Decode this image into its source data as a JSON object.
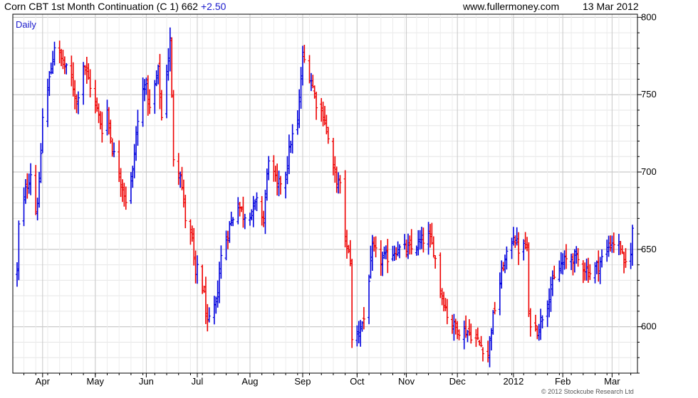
{
  "header": {
    "title": "Corn CBT 1st Month Continuation (C 1) 662",
    "change": "+2.50",
    "website": "www.fullermoney.com",
    "date": "13 Mar 2012"
  },
  "period_label": "Daily",
  "copyright": "© 2012 Stockcube Research Ltd",
  "colors": {
    "up": "#0000dd",
    "down": "#ee0000",
    "grid": "#d4d4d4",
    "axis": "#000000"
  },
  "chart_data": {
    "type": "ohlc",
    "title": "Corn CBT 1st Month Continuation (C 1) 662 +2.50",
    "y_ticks": [
      600,
      650,
      700,
      750,
      800
    ],
    "ylim": [
      570,
      802
    ],
    "grid": true,
    "y_axis_side": "right",
    "x_tick_labels": [
      "Apr",
      "May",
      "Jun",
      "Jul",
      "Aug",
      "Sep",
      "Oct",
      "Nov",
      "Dec",
      "2012",
      "Feb",
      "Mar"
    ],
    "x_tick_dates": [
      "2011-04-01",
      "2011-05-02",
      "2011-06-01",
      "2011-07-01",
      "2011-08-01",
      "2011-09-01",
      "2011-10-03",
      "2011-11-01",
      "2011-12-01",
      "2012-01-03",
      "2012-02-01",
      "2012-03-01"
    ],
    "date_range": [
      "2011-03-17",
      "2012-03-13"
    ],
    "path_points": [
      [
        "2011-03-17",
        635
      ],
      [
        "2011-03-18",
        665
      ],
      [
        "2011-03-22",
        688
      ],
      [
        "2011-03-25",
        700
      ],
      [
        "2011-03-28",
        675
      ],
      [
        "2011-03-30",
        690
      ],
      [
        "2011-04-01",
        735
      ],
      [
        "2011-04-05",
        760
      ],
      [
        "2011-04-08",
        782
      ],
      [
        "2011-04-13",
        770
      ],
      [
        "2011-04-18",
        760
      ],
      [
        "2011-04-21",
        745
      ],
      [
        "2011-04-25",
        770
      ],
      [
        "2011-04-28",
        760
      ],
      [
        "2011-05-03",
        740
      ],
      [
        "2011-05-06",
        728
      ],
      [
        "2011-05-09",
        740
      ],
      [
        "2011-05-12",
        715
      ],
      [
        "2011-05-17",
        695
      ],
      [
        "2011-05-20",
        682
      ],
      [
        "2011-05-24",
        700
      ],
      [
        "2011-05-26",
        725
      ],
      [
        "2011-05-31",
        760
      ],
      [
        "2011-06-03",
        740
      ],
      [
        "2011-06-08",
        765
      ],
      [
        "2011-06-10",
        735
      ],
      [
        "2011-06-13",
        765
      ],
      [
        "2011-06-15",
        785
      ],
      [
        "2011-06-17",
        710
      ],
      [
        "2011-06-21",
        700
      ],
      [
        "2011-06-24",
        670
      ],
      [
        "2011-06-28",
        655
      ],
      [
        "2011-06-30",
        630
      ],
      [
        "2011-07-01",
        640
      ],
      [
        "2011-07-05",
        620
      ],
      [
        "2011-07-07",
        600
      ],
      [
        "2011-07-12",
        615
      ],
      [
        "2011-07-15",
        645
      ],
      [
        "2011-07-20",
        665
      ],
      [
        "2011-07-25",
        680
      ],
      [
        "2011-07-28",
        672
      ],
      [
        "2011-08-02",
        675
      ],
      [
        "2011-08-05",
        680
      ],
      [
        "2011-08-09",
        670
      ],
      [
        "2011-08-12",
        710
      ],
      [
        "2011-08-17",
        690
      ],
      [
        "2011-08-22",
        700
      ],
      [
        "2011-08-25",
        720
      ],
      [
        "2011-08-29",
        732
      ],
      [
        "2011-09-01",
        775
      ],
      [
        "2011-09-06",
        760
      ],
      [
        "2011-09-09",
        745
      ],
      [
        "2011-09-14",
        735
      ],
      [
        "2011-09-19",
        700
      ],
      [
        "2011-09-23",
        690
      ],
      [
        "2011-09-27",
        650
      ],
      [
        "2011-09-29",
        645
      ],
      [
        "2011-09-30",
        590
      ],
      [
        "2011-10-05",
        600
      ],
      [
        "2011-10-07",
        605
      ],
      [
        "2011-10-12",
        650
      ],
      [
        "2011-10-17",
        643
      ],
      [
        "2011-10-21",
        645
      ],
      [
        "2011-10-26",
        650
      ],
      [
        "2011-11-01",
        650
      ],
      [
        "2011-11-04",
        650
      ],
      [
        "2011-11-09",
        655
      ],
      [
        "2011-11-14",
        658
      ],
      [
        "2011-11-17",
        650
      ],
      [
        "2011-11-21",
        625
      ],
      [
        "2011-11-25",
        608
      ],
      [
        "2011-11-29",
        600
      ],
      [
        "2011-12-02",
        598
      ],
      [
        "2011-12-07",
        597
      ],
      [
        "2011-12-12",
        592
      ],
      [
        "2011-12-15",
        588
      ],
      [
        "2011-12-19",
        582
      ],
      [
        "2011-12-21",
        600
      ],
      [
        "2011-12-23",
        612
      ],
      [
        "2011-12-28",
        640
      ],
      [
        "2011-12-30",
        645
      ],
      [
        "2012-01-03",
        660
      ],
      [
        "2012-01-06",
        650
      ],
      [
        "2012-01-11",
        652
      ],
      [
        "2012-01-12",
        605
      ],
      [
        "2012-01-17",
        598
      ],
      [
        "2012-01-20",
        607
      ],
      [
        "2012-01-25",
        625
      ],
      [
        "2012-01-31",
        640
      ],
      [
        "2012-02-03",
        643
      ],
      [
        "2012-02-08",
        645
      ],
      [
        "2012-02-14",
        638
      ],
      [
        "2012-02-17",
        635
      ],
      [
        "2012-02-22",
        640
      ],
      [
        "2012-02-27",
        650
      ],
      [
        "2012-03-01",
        655
      ],
      [
        "2012-03-06",
        652
      ],
      [
        "2012-03-08",
        638
      ],
      [
        "2012-03-12",
        650
      ],
      [
        "2012-03-13",
        662
      ]
    ]
  }
}
